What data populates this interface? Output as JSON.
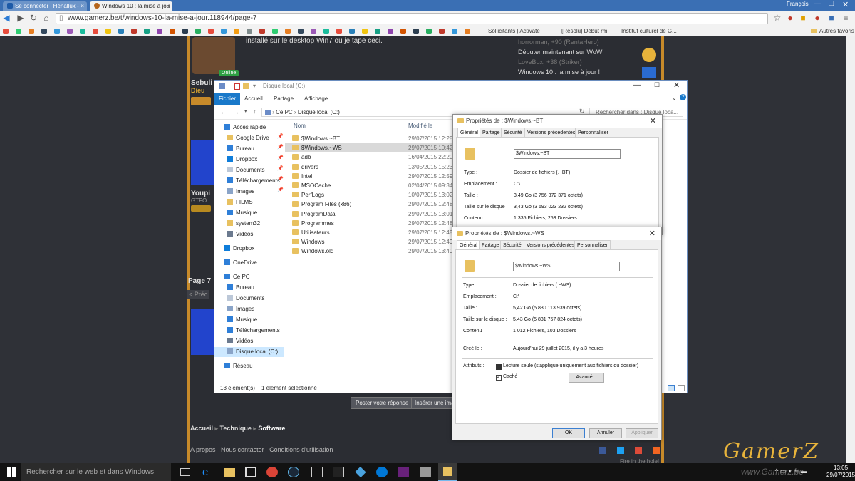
{
  "browser": {
    "tabs": [
      {
        "label": "Se connecter | Hénallux - ",
        "active": false
      },
      {
        "label": "Windows 10 : la mise à jou",
        "active": true
      }
    ],
    "user": "François",
    "url": "www.gamerz.be/t/windows-10-la-mise-a-jour.118944/page-7",
    "bookmarks": [
      {
        "label": "Sollicitants | Activate"
      },
      {
        "label": "[Résolu] Début rmi"
      },
      {
        "label": "Institut culturel de G..."
      }
    ],
    "other_bookmarks": "Autres favoris"
  },
  "forum": {
    "post_text": "installé sur le desktop Win7 ou je tape ceci.",
    "online_badge": "Online",
    "user1_name": "Sebuli",
    "user1_rank": "Dieu",
    "user2_name": "Youpi",
    "user2_rank": "GTFO",
    "sidebar": [
      {
        "text": "horrorman, +90 (RentaHero)"
      },
      {
        "text": "Débuter maintenant sur WoW"
      },
      {
        "text": "LoveBox, +38 (Striker)"
      },
      {
        "text": "Windows 10 : la mise à jour !"
      }
    ],
    "page_label": "Page 7",
    "prev_label": "< Préc",
    "post_reply_btn": "Poster votre réponse",
    "insert_btn": "Insérer une ima",
    "breadcrumbs": [
      "Accueil",
      "Technique",
      "Software"
    ],
    "footer_links": [
      "A propos",
      "Nous contacter",
      "Conditions d'utilisation"
    ],
    "footer_right": "Fire in the hole!",
    "logo": "GamerZ",
    "watermark": "www.Gamerz.be"
  },
  "explorer": {
    "title": "Disque local (C:)",
    "ribbon_tabs": [
      "Fichier",
      "Accueil",
      "Partage",
      "Affichage"
    ],
    "breadcrumb": [
      "Ce PC",
      "Disque local (C:)"
    ],
    "search_placeholder": "Rechercher dans : Disque loca...",
    "col_name": "Nom",
    "col_modified": "Modifié le",
    "nav": [
      {
        "label": "Accès rapide",
        "icon": "star-icon",
        "indent": 0,
        "pinned": false
      },
      {
        "label": "Google Drive",
        "icon": "folder-icon",
        "indent": 1,
        "pinned": true
      },
      {
        "label": "Bureau",
        "icon": "desktop-icon",
        "indent": 1,
        "pinned": true
      },
      {
        "label": "Dropbox",
        "icon": "dropbox-icon",
        "indent": 1,
        "pinned": true
      },
      {
        "label": "Documents",
        "icon": "documents-icon",
        "indent": 1,
        "pinned": true
      },
      {
        "label": "Téléchargements",
        "icon": "download-icon",
        "indent": 1,
        "pinned": true
      },
      {
        "label": "Images",
        "icon": "images-icon",
        "indent": 1,
        "pinned": true
      },
      {
        "label": "FILMS",
        "icon": "folder-icon",
        "indent": 1,
        "pinned": false
      },
      {
        "label": "Musique",
        "icon": "music-icon",
        "indent": 1,
        "pinned": false
      },
      {
        "label": "system32",
        "icon": "folder-icon",
        "indent": 1,
        "pinned": false
      },
      {
        "label": "Vidéos",
        "icon": "video-icon",
        "indent": 1,
        "pinned": false
      },
      {
        "label": "Dropbox",
        "icon": "dropbox-icon",
        "indent": 0,
        "pinned": false
      },
      {
        "label": "OneDrive",
        "icon": "onedrive-icon",
        "indent": 0,
        "pinned": false
      },
      {
        "label": "Ce PC",
        "icon": "pc-icon",
        "indent": 0,
        "pinned": false
      },
      {
        "label": "Bureau",
        "icon": "desktop-icon",
        "indent": 1,
        "pinned": false
      },
      {
        "label": "Documents",
        "icon": "documents-icon",
        "indent": 1,
        "pinned": false
      },
      {
        "label": "Images",
        "icon": "images-icon",
        "indent": 1,
        "pinned": false
      },
      {
        "label": "Musique",
        "icon": "music-icon",
        "indent": 1,
        "pinned": false
      },
      {
        "label": "Téléchargements",
        "icon": "download-icon",
        "indent": 1,
        "pinned": false
      },
      {
        "label": "Vidéos",
        "icon": "video-icon",
        "indent": 1,
        "pinned": false
      },
      {
        "label": "Disque local (C:)",
        "icon": "drive-icon",
        "indent": 1,
        "pinned": false,
        "selected": true
      },
      {
        "label": "Réseau",
        "icon": "network-icon",
        "indent": 0,
        "pinned": false
      }
    ],
    "files": [
      {
        "name": "$Windows.~BT",
        "date": "29/07/2015 12:28"
      },
      {
        "name": "$Windows.~WS",
        "date": "29/07/2015 10:42",
        "selected": true
      },
      {
        "name": "adb",
        "date": "16/04/2015 22:20"
      },
      {
        "name": "drivers",
        "date": "13/05/2015 15:23"
      },
      {
        "name": "Intel",
        "date": "29/07/2015 12:59"
      },
      {
        "name": "MSOCache",
        "date": "02/04/2015 09:34"
      },
      {
        "name": "PerfLogs",
        "date": "10/07/2015 13:02"
      },
      {
        "name": "Program Files (x86)",
        "date": "29/07/2015 12:48"
      },
      {
        "name": "ProgramData",
        "date": "29/07/2015 13:01"
      },
      {
        "name": "Programmes",
        "date": "29/07/2015 12:48"
      },
      {
        "name": "Utilisateurs",
        "date": "29/07/2015 12:48"
      },
      {
        "name": "Windows",
        "date": "29/07/2015 12:49"
      },
      {
        "name": "Windows.old",
        "date": "29/07/2015 13:40"
      }
    ],
    "status_count": "13 élément(s)",
    "status_selected": "1 élément sélectionné"
  },
  "props_bt": {
    "title": "Propriétés de : $Windows.~BT",
    "tabs": [
      "Général",
      "Partage",
      "Sécurité",
      "Versions précédentes",
      "Personnaliser"
    ],
    "name": "$Windows.~BT",
    "rows": [
      {
        "label": "Type :",
        "value": "Dossier de fichiers (.~BT)"
      },
      {
        "label": "Emplacement :",
        "value": "C:\\"
      },
      {
        "label": "Taille :",
        "value": "3,49 Go (3 756 372 371 octets)"
      },
      {
        "label": "Taille sur le disque :",
        "value": "3,43 Go (3 693 023 232 octets)"
      },
      {
        "label": "Contenu :",
        "value": "1 335 Fichiers, 253 Dossiers"
      }
    ]
  },
  "props_ws": {
    "title": "Propriétés de : $Windows.~WS",
    "tabs": [
      "Général",
      "Partage",
      "Sécurité",
      "Versions précédentes",
      "Personnaliser"
    ],
    "name": "$Windows.~WS",
    "rows": [
      {
        "label": "Type :",
        "value": "Dossier de fichiers (.~WS)"
      },
      {
        "label": "Emplacement :",
        "value": "C:\\"
      },
      {
        "label": "Taille :",
        "value": "5,42 Go (5 830 113 939 octets)"
      },
      {
        "label": "Taille sur le disque :",
        "value": "5,43 Go (5 831 757 824 octets)"
      },
      {
        "label": "Contenu :",
        "value": "1 012 Fichiers, 103 Dossiers"
      }
    ],
    "created_label": "Créé le :",
    "created_value": "Aujourd'hui 29 juillet 2015, il y a 3 heures",
    "attributes_label": "Attributs :",
    "readonly_label": "Lecture seule (s'applique uniquement aux fichiers du dossier)",
    "hidden_label": "Caché",
    "advanced_btn": "Avancé...",
    "ok_btn": "OK",
    "cancel_btn": "Annuler",
    "apply_btn": "Appliquer"
  },
  "taskbar": {
    "search_placeholder": "Rechercher sur le web et dans Windows",
    "time": "13:05",
    "date": "29/07/2015"
  },
  "colors": {
    "accent": "#1979ca",
    "folder": "#e8c160",
    "taskbar": "#121212",
    "tabbar": "#3a6fb4"
  }
}
